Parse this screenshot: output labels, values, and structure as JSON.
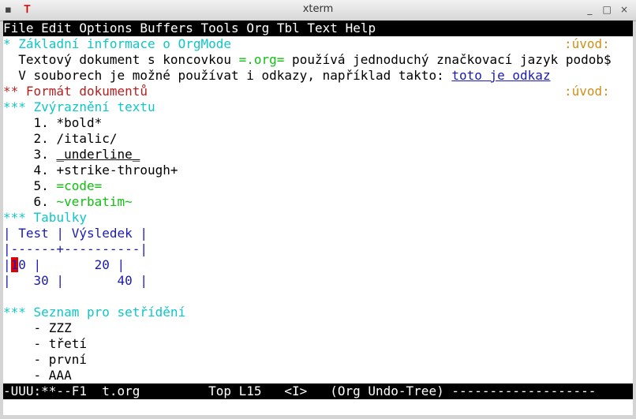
{
  "window": {
    "title": "xterm",
    "left_controls": [
      "▪",
      "Ꭲ"
    ],
    "right_controls": [
      "_",
      "□",
      "×"
    ]
  },
  "menubar": {
    "items": [
      "File",
      "Edit",
      "Options",
      "Buffers",
      "Tools",
      "Org",
      "Tbl",
      "Text",
      "Help"
    ]
  },
  "buffer": {
    "heading1_stars": "*",
    "heading1_text": " Základní informace o OrgMode",
    "heading1_tag": ":úvod:",
    "para1_a": "  Textový dokument s koncovkou ",
    "para1_code": "=.org=",
    "para1_b": " používá jednoduchý značkovací jazyk podob$",
    "para2_a": "  V souborech je možné používat i odkazy, například takto: ",
    "para2_link": "toto je odkaz",
    "heading2_stars": "**",
    "heading2_text": " Formát dokumentů",
    "heading2_tag": ":úvod:",
    "heading3a_stars": "***",
    "heading3a_text": " Zvýraznění textu",
    "list": [
      {
        "num": "    1. ",
        "text": "*bold*"
      },
      {
        "num": "    2. ",
        "text": "/italic/"
      },
      {
        "num": "    3. ",
        "text": "_underline_"
      },
      {
        "num": "    4. ",
        "text": "+strike-through+"
      },
      {
        "num": "    5. ",
        "text": "=code="
      },
      {
        "num": "    6. ",
        "text": "~verbatim~"
      }
    ],
    "heading3b_stars": "***",
    "heading3b_text": " Tabulky",
    "table": {
      "header": "| Test | Výsledek |",
      "rule": "|------+----------|",
      "row1_pipe": "|",
      "row1_cursor": "1",
      "row1_rest": "0 |       20 |",
      "row2": "|   30 |       40 |"
    },
    "heading3c_stars": "***",
    "heading3c_text": " Seznam pro setřídění",
    "sort_list": [
      "    - ZZZ",
      "    - třetí",
      "    - první",
      "    - AAA"
    ]
  },
  "modeline": {
    "text": "-UUU:**--F1  t.org         Top L15   <I>   (Org Undo-Tree) -------------------"
  },
  "colors": {
    "heading1": "#10c6c6",
    "heading2": "#b82020",
    "tag": "#d08e18",
    "code": "#10c010",
    "table": "#1a1ab8",
    "cursor": "#e00000"
  }
}
